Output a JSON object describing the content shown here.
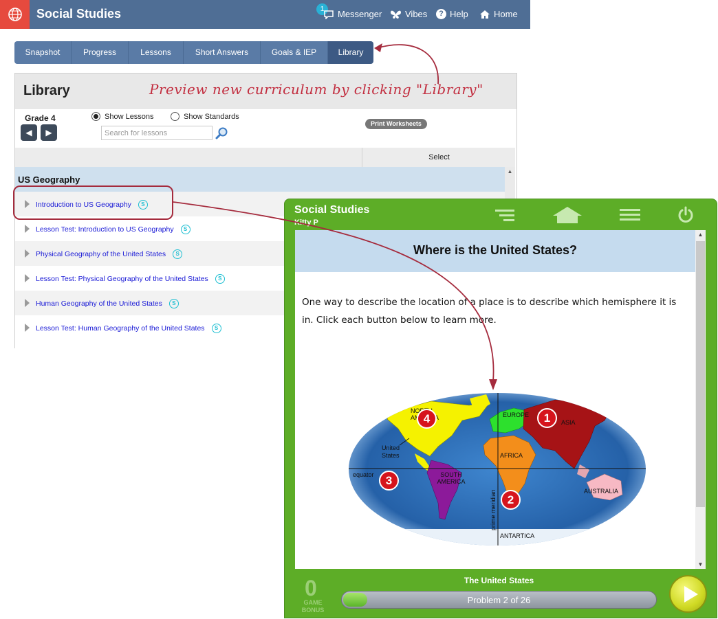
{
  "app": {
    "title": "Social Studies"
  },
  "topnav": {
    "messenger_badge": "1",
    "items": [
      "Messenger",
      "Vibes",
      "Help",
      "Home"
    ]
  },
  "tabs": [
    "Snapshot",
    "Progress",
    "Lessons",
    "Short Answers",
    "Goals & IEP",
    "Library"
  ],
  "active_tab": "Library",
  "library": {
    "title": "Library",
    "callout": "Preview new curriculum by clicking \"Library\"",
    "grade": "Grade 4",
    "radio_lessons": "Show Lessons",
    "radio_standards": "Show Standards",
    "selected_view": "Show Lessons",
    "search_placeholder": "Search for lessons",
    "print_button": "Print Worksheets",
    "select_header": "Select",
    "unit": "US Geography",
    "lessons": [
      "Introduction to US Geography",
      "Lesson Test: Introduction to US Geography",
      "Physical Geography of the United States",
      "Lesson Test: Physical Geography of the United States",
      "Human Geography of the United States",
      "Lesson Test: Human Geography of the United States"
    ],
    "lesson_icon": "S"
  },
  "preview": {
    "title": "Social Studies",
    "user": "Kitty P",
    "question_title": "Where is the United States?",
    "question_text": "One way to describe the location of a place is to describe which hemisphere it is in. Click each button below to learn more.",
    "map_labels": {
      "north_america": "NORTH AMERICA",
      "europe": "EUROPE",
      "asia": "ASIA",
      "africa": "AFRICA",
      "south_america": "SOUTH AMERICA",
      "australia": "AUSTRALIA",
      "antartica": "ANTARTICA",
      "united_states": "United States",
      "equator": "equator",
      "prime_meridian": "prime meridian"
    },
    "hemisphere_buttons": [
      "1",
      "2",
      "3",
      "4"
    ],
    "game_bonus_value": "0",
    "game_bonus_label": "GAME BONUS",
    "lesson_name": "The United States",
    "progress_text": "Problem 2 of 26",
    "progress_fraction": 0.077
  },
  "colors": {
    "topbar": "#4f6e95",
    "accent_red": "#c22d3f",
    "preview_green": "#5dad27",
    "ocean": "#2f6fb6"
  }
}
